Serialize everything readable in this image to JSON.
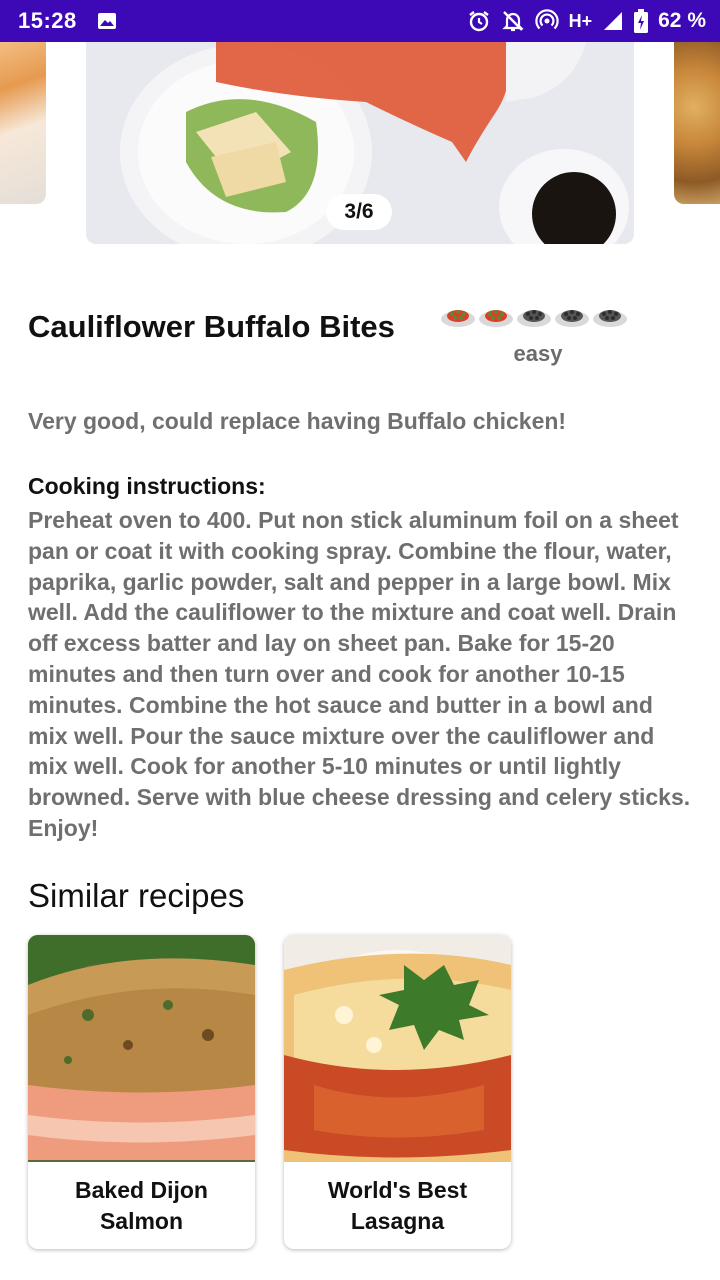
{
  "status_bar": {
    "time": "15:28",
    "network": "H+",
    "battery": "62 %",
    "icons": [
      "image-icon",
      "alarm-icon",
      "notifications-off-icon",
      "hotspot-icon",
      "signal-icon",
      "battery-icon"
    ]
  },
  "carousel": {
    "counter": "3/6"
  },
  "recipe": {
    "title": "Cauliflower Buffalo Bites",
    "difficulty": {
      "label": "easy",
      "rating": 2,
      "max": 5,
      "active_color": "#d8402c",
      "inactive_color": "#555555"
    },
    "comment": "Very good, could replace having Buffalo chicken!",
    "instructions_heading": "Cooking instructions:",
    "instructions": "Preheat oven to 400. Put non stick aluminum foil on a sheet pan or coat it with cooking spray. Combine the flour, water, paprika, garlic powder, salt and pepper in a large bowl. Mix well. Add the cauliflower to the mixture and coat well. Drain off excess batter and lay on sheet pan. Bake for 15-20 minutes and then turn over and cook for another 10-15 minutes. Combine the hot sauce and butter in a bowl and mix well. Pour the sauce mixture over the cauliflower and mix well. Cook for another 5-10 minutes or until lightly browned. Serve with blue cheese dressing and celery sticks. Enjoy!"
  },
  "similar": {
    "heading": "Similar recipes",
    "items": [
      {
        "title": "Baked Dijon Salmon"
      },
      {
        "title": "World's Best Lasagna"
      }
    ]
  },
  "colors": {
    "status_bar": "#3d08b5",
    "text_primary": "#111111",
    "text_secondary": "#707070"
  }
}
